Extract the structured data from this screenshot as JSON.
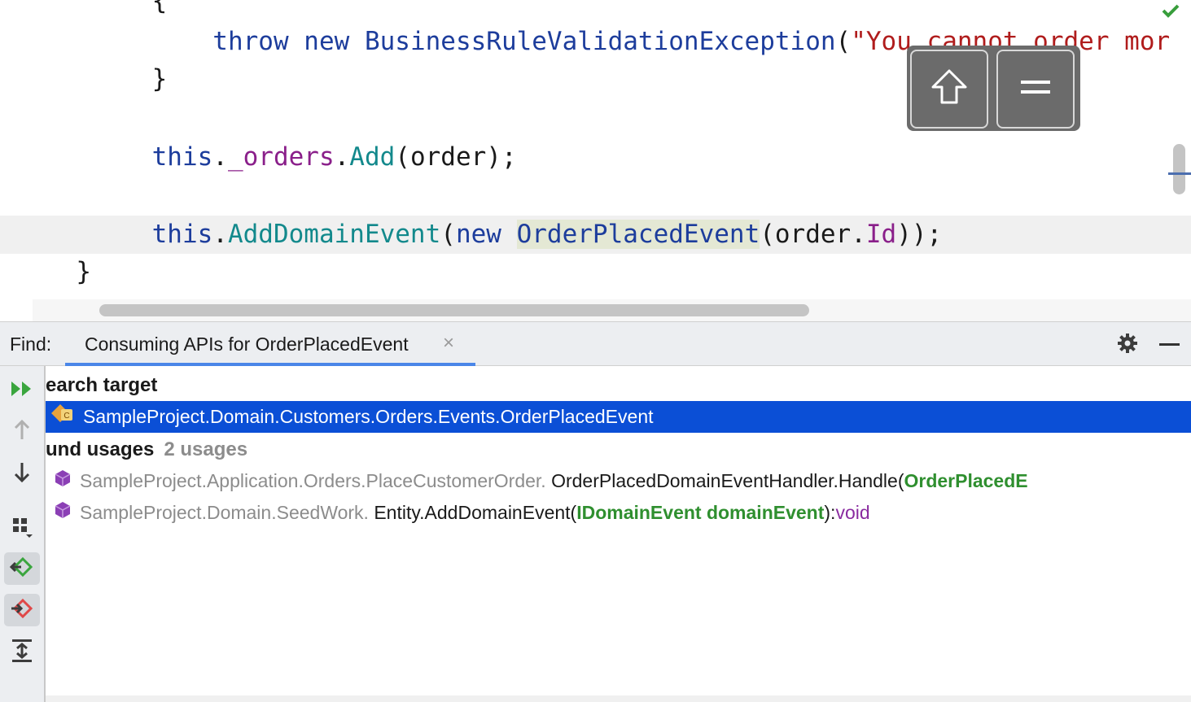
{
  "editor": {
    "lines": {
      "brace_open": "{",
      "throw_kw": "throw",
      "new_kw": "new",
      "exception_type": "BusinessRuleValidationException",
      "open_paren": "(",
      "exception_msg": "\"You cannot order mor",
      "brace_close": "}",
      "this1": "this",
      "dot1": ".",
      "orders_field": "_orders",
      "dot2": ".",
      "add_method": "Add",
      "add_args": "(order);",
      "this2": "this",
      "dot3": ".",
      "adddomainevent_method": "AddDomainEvent",
      "paren2": "(",
      "new_kw2": "new",
      "event_type": "OrderPlacedEvent",
      "order_arg": "(order.",
      "id_field": "Id",
      "tail": "));",
      "method_close": "}"
    },
    "status_icon": "check-icon"
  },
  "overlay": {
    "shift_icon": "shift-arrow-icon",
    "equals_icon": "equals-icon"
  },
  "find": {
    "label": "Find:",
    "tab_label": "Consuming APIs for OrderPlacedEvent",
    "tab_close": "×",
    "settings_icon": "gear-icon",
    "minimize_icon": "minimize-icon",
    "toolbar": [
      "rerun-icon",
      "up-arrow-icon",
      "down-arrow-icon",
      "group-icon",
      "usage-in-icon",
      "usage-out-icon",
      "expand-all-icon"
    ]
  },
  "results": {
    "search_target_header": "earch target",
    "target_item": "SampleProject.Domain.Customers.Orders.Events.OrderPlacedEvent",
    "found_header": "und usages",
    "found_count": "2 usages",
    "usages": [
      {
        "namespace": "SampleProject.Application.Orders.PlaceCustomerOrder.",
        "member": "OrderPlacedDomainEventHandler.Handle(",
        "param": "OrderPlacedE",
        "tail": "",
        "ret": ""
      },
      {
        "namespace": "SampleProject.Domain.SeedWork.",
        "member": "Entity.AddDomainEvent(",
        "param": "IDomainEvent domainEvent",
        "tail": "):",
        "ret": "void"
      }
    ]
  },
  "colors": {
    "selection": "#0b4fd6",
    "keyword": "#1d3d9c",
    "string": "#b01c1c",
    "field": "#8a1f8a",
    "method": "#13898c",
    "param": "#2f8f2f"
  }
}
